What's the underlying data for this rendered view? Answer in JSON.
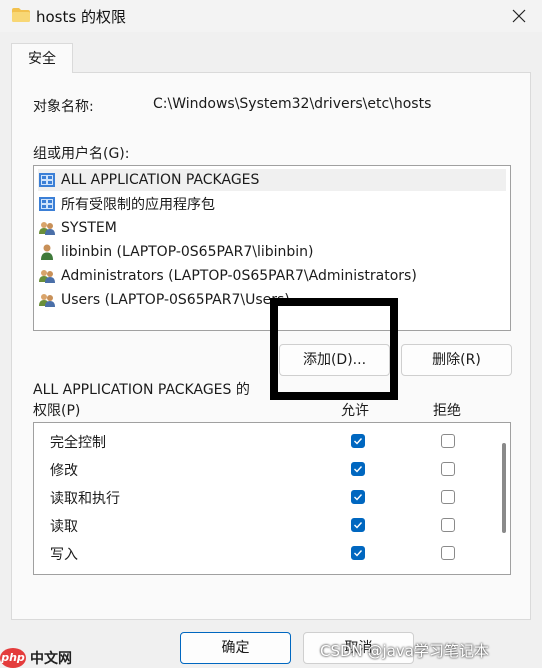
{
  "window": {
    "title": "hosts 的权限"
  },
  "tab": {
    "label": "安全"
  },
  "object": {
    "label": "对象名称:",
    "value": "C:\\Windows\\System32\\drivers\\etc\\hosts"
  },
  "groups": {
    "label": "组或用户名(G):",
    "items": [
      {
        "name": "ALL APPLICATION PACKAGES",
        "icon": "package-icon",
        "selected": true
      },
      {
        "name": "所有受限制的应用程序包",
        "icon": "package-icon",
        "selected": false
      },
      {
        "name": "SYSTEM",
        "icon": "users-group-icon",
        "selected": false
      },
      {
        "name": "libinbin (LAPTOP-0S65PAR7\\libinbin)",
        "icon": "user-icon",
        "selected": false
      },
      {
        "name": "Administrators (LAPTOP-0S65PAR7\\Administrators)",
        "icon": "users-group-icon",
        "selected": false
      },
      {
        "name": "Users (LAPTOP-0S65PAR7\\Users)",
        "icon": "users-group-icon",
        "selected": false
      }
    ]
  },
  "buttons": {
    "add": "添加(D)...",
    "remove": "删除(R)",
    "ok": "确定",
    "cancel": "取消"
  },
  "permissions": {
    "label_line1": "ALL APPLICATION PACKAGES 的",
    "label_line2": "权限(P)",
    "allow_header": "允许",
    "deny_header": "拒绝",
    "rows": [
      {
        "name": "完全控制",
        "allow": true,
        "deny": false
      },
      {
        "name": "修改",
        "allow": true,
        "deny": false
      },
      {
        "name": "读取和执行",
        "allow": true,
        "deny": false
      },
      {
        "name": "读取",
        "allow": true,
        "deny": false
      },
      {
        "name": "写入",
        "allow": true,
        "deny": false
      }
    ]
  },
  "watermark": {
    "text": "CSDN @java学习笔记本"
  },
  "logo": {
    "badge": "php",
    "text": "中文网"
  },
  "colors": {
    "accent": "#0067c0",
    "highlight": "#000000"
  }
}
